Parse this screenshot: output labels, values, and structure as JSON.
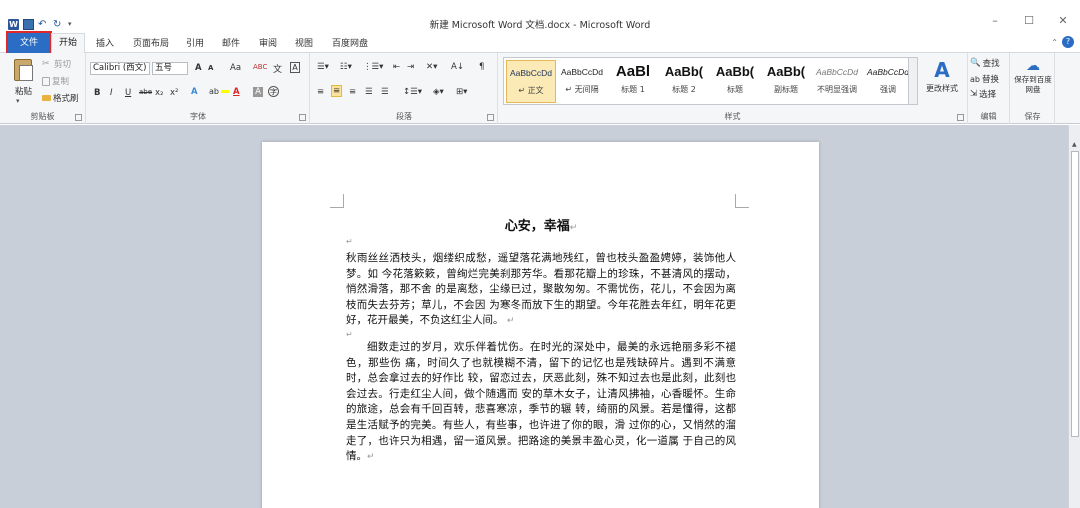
{
  "window": {
    "title": "新建 Microsoft Word 文档.docx - Microsoft Word",
    "quick_access": [
      "word-logo-icon",
      "save-icon",
      "undo-icon",
      "redo-icon"
    ],
    "controls": [
      "minimize-icon",
      "maximize-icon",
      "close-icon"
    ]
  },
  "tabs": {
    "file": "文件",
    "items": [
      "开始",
      "插入",
      "页面布局",
      "引用",
      "邮件",
      "审阅",
      "视图",
      "百度网盘"
    ]
  },
  "ribbon": {
    "clipboard": {
      "paste": "粘贴",
      "cut": "剪切",
      "copy": "复制",
      "format_painter": "格式刷",
      "label": "剪贴板"
    },
    "font": {
      "font_name": "Calibri (西文)",
      "font_size": "五号",
      "grow": "A",
      "shrink": "A",
      "change_case": "Aa",
      "clear_format": "ABC",
      "bold": "B",
      "italic": "I",
      "underline": "U",
      "strike": "abe",
      "subscript": "x₂",
      "superscript": "x²",
      "label": "字体"
    },
    "paragraph": {
      "label": "段落"
    },
    "styles": {
      "items": [
        {
          "sample": "AaBbCcDd",
          "name": "↵ 正文"
        },
        {
          "sample": "AaBbCcDd",
          "name": "↵ 无间隔"
        },
        {
          "sample": "AaBl",
          "name": "标题 1"
        },
        {
          "sample": "AaBb(",
          "name": "标题 2"
        },
        {
          "sample": "AaBb(",
          "name": "标题"
        },
        {
          "sample": "AaBb(",
          "name": "副标题"
        },
        {
          "sample": "AaBbCcDd",
          "name": "不明显强调"
        },
        {
          "sample": "AaBbCcDd",
          "name": "强调"
        }
      ],
      "change_styles": "更改样式",
      "label": "样式"
    },
    "editing": {
      "find": "查找",
      "replace": "替换",
      "select": "选择",
      "label": "编辑"
    },
    "save": {
      "button": "保存到百度网盘",
      "label": "保存"
    }
  },
  "document": {
    "title": "心安，幸福",
    "paragraph_mark": "↵",
    "paragraphs": [
      "秋雨丝丝洒枝头，烟缕织成愁，遥望落花满地残红，曾也枝头盈盈娉婷，装饰他人梦。如 今花落簌簌，曾绚烂完美刹那芳华。看那花瓣上的珍珠，不甚清风的摆动，悄然滑落，那不舍 的是离愁，尘缘已过，聚散匆匆。不需忧伤，花儿，不会因为离枝而失去芬芳；草儿，不会因 为寒冬而放下生的期望。今年花胜去年红，明年花更好，花开最美，不负这红尘人间。",
      "细数走过的岁月，欢乐伴着忧伤。在时光的深处中，最美的永远艳丽多彩不褪色，那些伤 痛，时间久了也就模糊不清，留下的记忆也是残缺碎片。遇到不满意时，总会拿过去的好作比 较，留恋过去，厌恶此刻，殊不知过去也是此刻，此刻也会过去。行走红尘人间，做个随遇而 安的草木女子，让清风拂袖，心香暖怀。生命的旅途，总会有千回百转，悲喜寒凉，季节的辗 转，绮丽的风景。若是懂得，这都是生活赋予的完美。有些人，有些事，也许进了你的眼，滑 过你的心，又悄然的溜走了，也许只为相遇，留一道风景。把路途的美景丰盈心灵，化一道属 于自己的风情。"
    ]
  }
}
